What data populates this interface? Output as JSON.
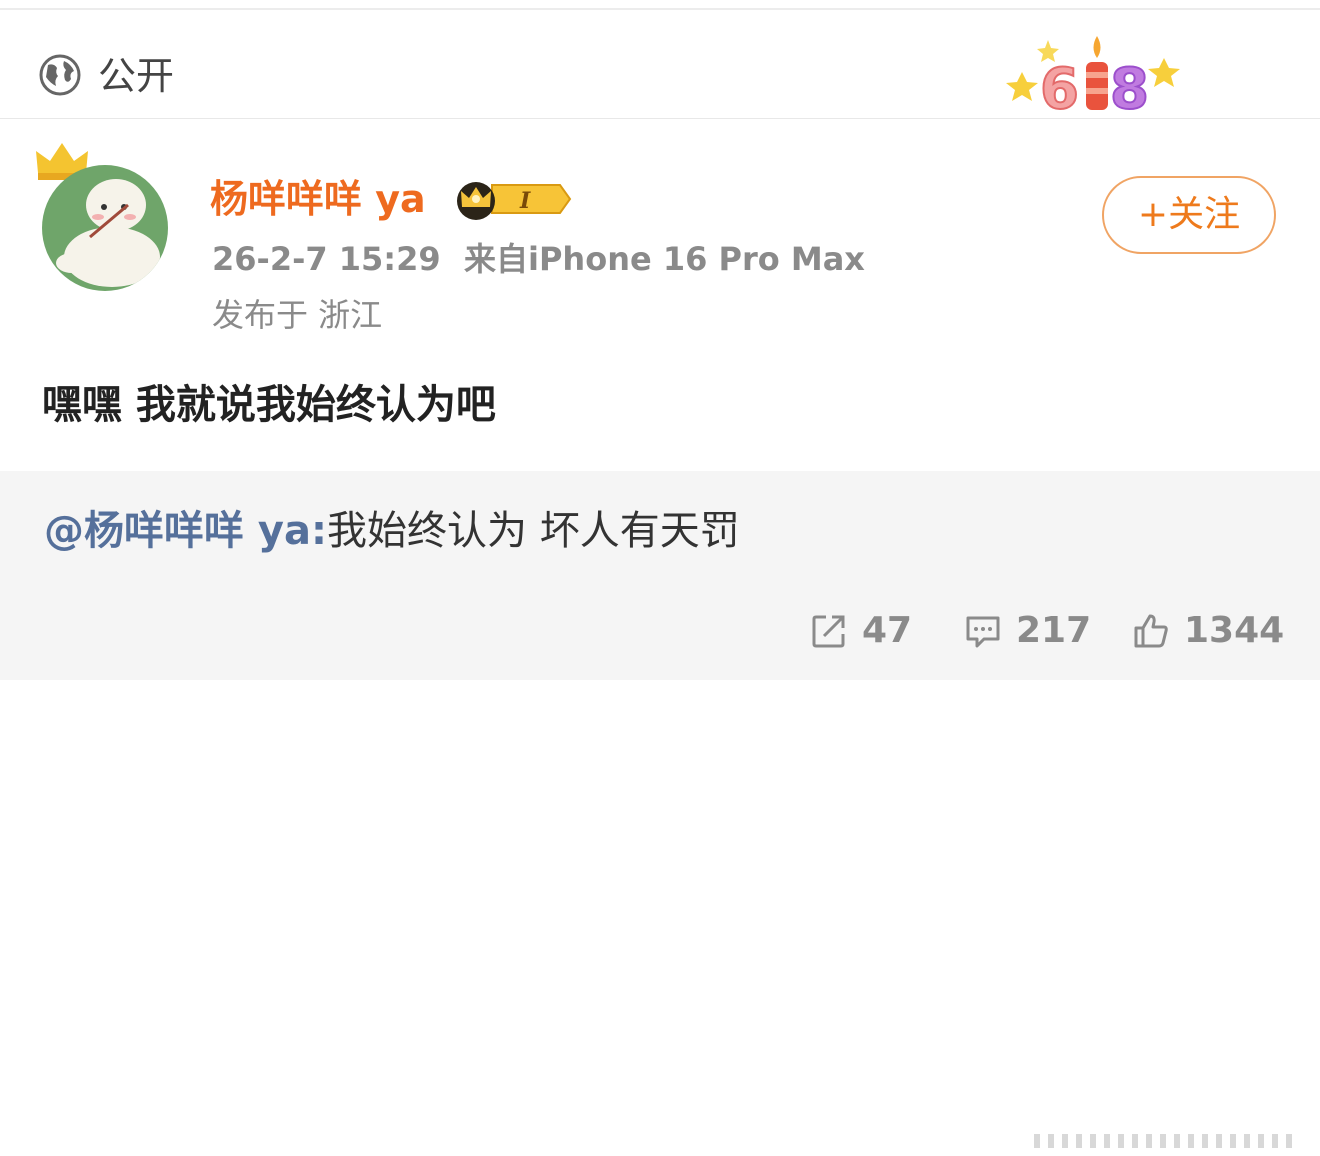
{
  "visibility": {
    "label": "公开",
    "icon": "globe-icon"
  },
  "promo": {
    "text": "618",
    "icon": "birthday-candle-618-icon"
  },
  "post": {
    "username": "杨咩咩咩 ya",
    "badge": {
      "level": "I",
      "icon": "crown-level-badge-icon"
    },
    "time": "26-2-7 15:29",
    "source": "来自iPhone 16 Pro Max",
    "location": "发布于 浙江",
    "follow_label": "+关注",
    "text": "嘿嘿 我就说我始终认为吧"
  },
  "quoted": {
    "mention": "@杨咩咩咩 ya:",
    "text": "我始终认为 坏人有天罚"
  },
  "actions": {
    "repost_count": "47",
    "comment_count": "217",
    "like_count": "1344"
  },
  "colors": {
    "username": "#ee6a1f",
    "follow": "#ee7a1c",
    "mention": "#55709b",
    "meta": "#8a8a8a",
    "quote_bg": "#f5f5f5"
  }
}
